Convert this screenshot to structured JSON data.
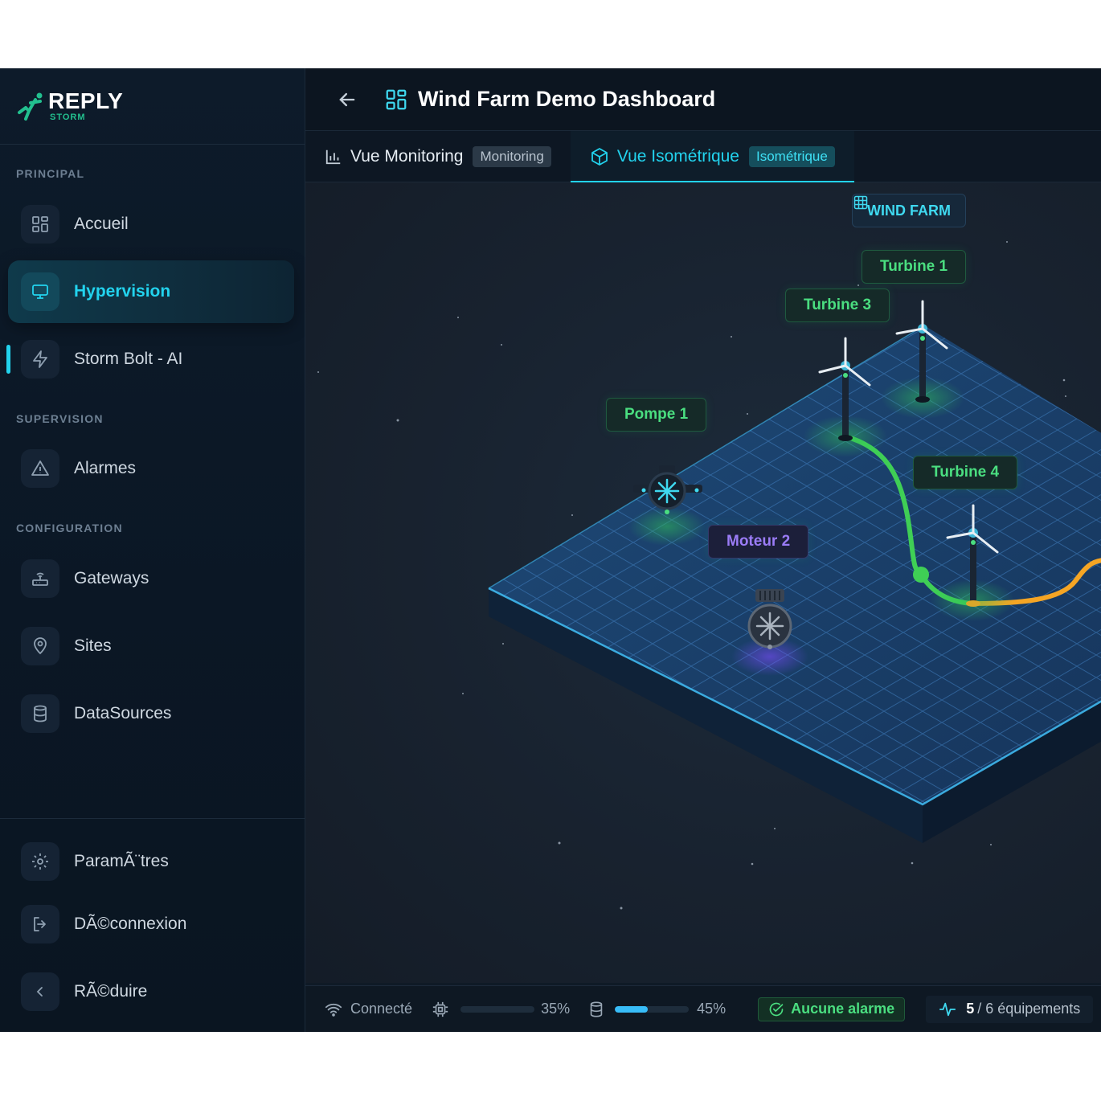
{
  "brand": {
    "name": "REPLY",
    "sub": "STORM"
  },
  "sidebar": {
    "sections": [
      "PRINCIPAL",
      "SUPERVISION",
      "CONFIGURATION"
    ],
    "items": [
      {
        "label": "Accueil",
        "icon": "grid-icon"
      },
      {
        "label": "Hypervision",
        "icon": "monitor-icon",
        "active": true
      },
      {
        "label": "Storm Bolt - AI",
        "icon": "bolt-icon"
      },
      {
        "label": "Alarmes",
        "icon": "warning-icon"
      },
      {
        "label": "Gateways",
        "icon": "router-icon"
      },
      {
        "label": "Sites",
        "icon": "map-pin-icon"
      },
      {
        "label": "DataSources",
        "icon": "database-icon"
      }
    ],
    "footer": [
      {
        "label": "ParamÃ¨tres",
        "icon": "gear-icon"
      },
      {
        "label": "DÃ©connexion",
        "icon": "logout-icon"
      },
      {
        "label": "RÃ©duire",
        "icon": "chevron-left-icon"
      }
    ]
  },
  "header": {
    "title": "Wind Farm Demo Dashboard"
  },
  "tabs": [
    {
      "label": "Vue Monitoring",
      "badge": "Monitoring"
    },
    {
      "label": "Vue Isométrique",
      "badge": "Isométrique",
      "active": true
    }
  ],
  "scene": {
    "farm_label": "WIND FARM",
    "equipment": [
      {
        "label": "Turbine 1",
        "type": "turbine",
        "status": "ok"
      },
      {
        "label": "Turbine 3",
        "type": "turbine",
        "status": "ok"
      },
      {
        "label": "Pompe 1",
        "type": "pump",
        "status": "ok"
      },
      {
        "label": "Turbine 4",
        "type": "turbine",
        "status": "ok"
      },
      {
        "label": "Moteur 2",
        "type": "motor",
        "status": "offline"
      }
    ]
  },
  "status": {
    "connection": "Connecté",
    "cpu": {
      "value": "35%",
      "fraction": 0.0
    },
    "storage": {
      "value": "45%",
      "fraction": 0.45
    },
    "alarm": "Aucune alarme",
    "equipment": {
      "online": "5",
      "total": "/ 6 équipements"
    }
  },
  "colors": {
    "accent": "#22d3ee",
    "ok": "#4ade80",
    "offline": "#9b7cf7",
    "pipe_warning": "#f59e0b"
  }
}
